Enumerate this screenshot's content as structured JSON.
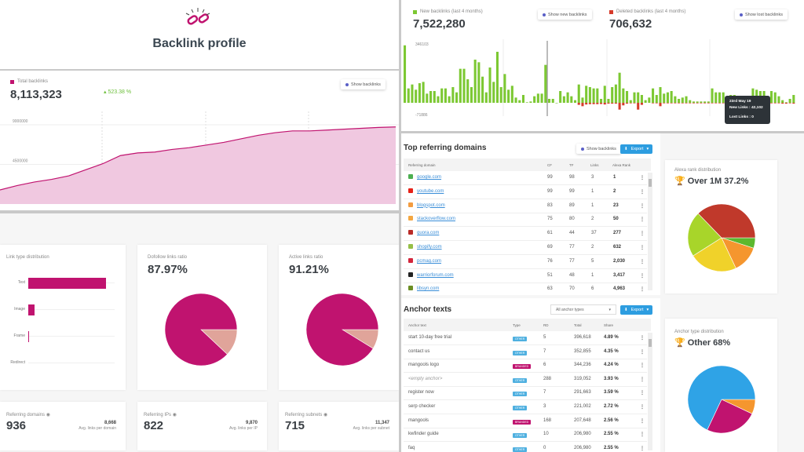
{
  "header": {
    "title": "Backlink profile",
    "icon": "broken-link-icon"
  },
  "total": {
    "label": "Total backlinks",
    "value": "8,113,323",
    "change": "523.38 %",
    "button": "Show backlinks",
    "chart_data": {
      "type": "area",
      "yticks": [
        "9000000",
        "4500000"
      ],
      "ylim": [
        0,
        9800000
      ],
      "values": [
        1600000,
        2100000,
        2500000,
        2800000,
        3200000,
        3900000,
        4600000,
        5500000,
        5800000,
        5900000,
        6200000,
        6400000,
        6700000,
        7000000,
        7400000,
        7800000,
        8100000,
        8300000,
        8300000,
        8400000,
        8500000,
        8600000,
        8700000,
        8750000
      ],
      "color": "#c0136f",
      "fill": "#f0c8e0"
    }
  },
  "newlinks": {
    "label": "New backlinks (last 4 months)",
    "value": "7,522,280",
    "button": "Show new backlinks"
  },
  "deleted": {
    "label": "Deleted backlinks (last 4 months)",
    "value": "706,632",
    "button": "Show lost backlinks"
  },
  "bars": {
    "chart_data": {
      "type": "bar",
      "yticks": [
        "346103",
        "-71886"
      ],
      "ylim": [
        -71886,
        346103
      ],
      "colors": {
        "new": "#7cc832",
        "deleted": "#d63a2a"
      },
      "new": [
        338000,
        84600,
        107700,
        76900,
        115400,
        123000,
        53800,
        69200,
        69200,
        38500,
        84600,
        84600,
        38500,
        92300,
        61500,
        200000,
        200000,
        138400,
        92300,
        253800,
        238400,
        153800,
        61500,
        207600,
        123000,
        300000,
        92300,
        169200,
        76900,
        100000,
        30800,
        15400,
        46100,
        3100,
        7700,
        38500,
        53800,
        53800,
        223000,
        23100,
        23100,
        0,
        69200,
        38500,
        61500,
        38500,
        15400,
        107700,
        30800,
        100000,
        92300,
        84600,
        84600,
        23100,
        100000,
        23100,
        92300,
        107700,
        176900,
        84600,
        69200,
        15400,
        61500,
        61500,
        46100,
        15400,
        30800,
        84600,
        46100,
        92300,
        53800,
        61500,
        69200,
        38500,
        23100,
        30800,
        38500,
        15400,
        7700,
        7700,
        7700,
        7700,
        7700,
        84600,
        61500,
        61500,
        61500,
        15400,
        46100,
        46100,
        7700,
        7700,
        30800,
        7700,
        84600,
        76900,
        69200,
        69200,
        23100,
        69200,
        61500,
        38500,
        15400,
        3100,
        23100,
        46100
      ],
      "deleted": [
        0,
        0,
        0,
        0,
        0,
        0,
        0,
        0,
        0,
        0,
        0,
        0,
        0,
        0,
        0,
        0,
        0,
        0,
        0,
        0,
        0,
        0,
        0,
        0,
        0,
        0,
        0,
        0,
        0,
        0,
        0,
        0,
        0,
        0,
        0,
        0,
        0,
        0,
        0,
        0,
        0,
        0,
        0,
        0,
        0,
        0,
        0,
        -12000,
        -20000,
        -10000,
        -8000,
        -8000,
        -8000,
        -7000,
        -10000,
        -5000,
        -5000,
        -5000,
        -40000,
        -15000,
        -5000,
        -3000,
        -3000,
        -40000,
        -12000,
        0,
        0,
        -3000,
        -3000,
        -20000,
        -3000,
        -3000,
        -3000,
        -3000,
        -3000,
        -3000,
        -3000,
        -3000,
        -3000,
        -3000,
        -3000,
        -3000,
        -3000,
        -3000,
        -3000,
        -3000,
        -3000,
        -3000,
        -3000,
        -40000,
        -30000,
        -25000,
        -15000,
        -5000,
        -5000,
        -3000,
        0,
        0,
        -5000,
        -3000,
        -3000,
        -3000,
        -5000,
        -5000,
        -3000,
        -5000
      ]
    },
    "tooltip": {
      "date": "23rd May 19",
      "new": "New Links : 42,102",
      "lost": "Lost Links : 0"
    }
  },
  "linktype": {
    "title": "Link type distribution",
    "chart_data": {
      "type": "bar",
      "categories": [
        "Text",
        "Image",
        "Frame",
        "Redirect"
      ],
      "values": [
        100,
        8,
        1.5,
        0
      ],
      "color": "#c0136f"
    }
  },
  "dofollow": {
    "title": "Dofollow links ratio",
    "value": "87.97%",
    "chart_data": {
      "type": "pie",
      "values": [
        12.03,
        87.97
      ],
      "colors": [
        "#e0a49a",
        "#c0136f"
      ]
    }
  },
  "active": {
    "title": "Active links ratio",
    "value": "91.21%",
    "chart_data": {
      "type": "pie",
      "values": [
        8.79,
        91.21
      ],
      "colors": [
        "#e0a49a",
        "#c0136f"
      ]
    }
  },
  "stats": [
    {
      "label": "Referring domains",
      "value": "936",
      "sub": "8,668",
      "sublabel": "Avg. links per domain"
    },
    {
      "label": "Referring IPs",
      "value": "822",
      "sub": "9,870",
      "sublabel": "Avg. links per IP"
    },
    {
      "label": "Referring subnets",
      "value": "715",
      "sub": "11,347",
      "sublabel": "Avg. links per subnet"
    }
  ],
  "domains": {
    "title": "Top referring domains",
    "button": "Show backlinks",
    "export": "Export",
    "columns": [
      "Referring domain",
      "CF",
      "TF",
      "Links",
      "Alexa Rank"
    ],
    "rows": [
      [
        "google.com",
        "99",
        "98",
        "3",
        "1",
        "#4caf50"
      ],
      [
        "youtube.com",
        "99",
        "99",
        "1",
        "2",
        "#e62117"
      ],
      [
        "blogspot.com",
        "83",
        "89",
        "1",
        "23",
        "#f39c40"
      ],
      [
        "stackoverflow.com",
        "75",
        "80",
        "2",
        "50",
        "#f4a742"
      ],
      [
        "quora.com",
        "61",
        "44",
        "37",
        "277",
        "#b92b27"
      ],
      [
        "shopify.com",
        "69",
        "77",
        "2",
        "632",
        "#95bf47"
      ],
      [
        "pcmag.com",
        "76",
        "77",
        "5",
        "2,030",
        "#d3253b"
      ],
      [
        "warriorforum.com",
        "51",
        "48",
        "1",
        "3,417",
        "#222222"
      ],
      [
        "libsyn.com",
        "63",
        "70",
        "6",
        "4,963",
        "#6b8e23"
      ]
    ]
  },
  "alexa": {
    "title": "Alexa rank distribution",
    "headline": "Over 1M 37.2%",
    "chart_data": {
      "type": "pie",
      "values": [
        5,
        13,
        23,
        21.8,
        37.2
      ],
      "colors": [
        "#5cb82e",
        "#f5962e",
        "#f0d22a",
        "#a8d52a",
        "#c0392b"
      ]
    }
  },
  "anchors": {
    "title": "Anchor texts",
    "select": "All anchor types",
    "export": "Export",
    "columns": [
      "Anchor text",
      "Type",
      "RD",
      "Total",
      "Share"
    ],
    "rows": [
      [
        "start 10-day free trial",
        "OTHER",
        "5",
        "396,618",
        "4.89 %"
      ],
      [
        "contact us",
        "OTHER",
        "7",
        "352,855",
        "4.35 %"
      ],
      [
        "mangools logo",
        "BRANDED",
        "6",
        "344,236",
        "4.24 %"
      ],
      [
        "<empty anchor>",
        "OTHER",
        "288",
        "319,052",
        "3.93 %"
      ],
      [
        "register now",
        "OTHER",
        "7",
        "291,663",
        "3.59 %"
      ],
      [
        "serp checker",
        "OTHER",
        "3",
        "221,002",
        "2.72 %"
      ],
      [
        "mangools",
        "BRANDED",
        "168",
        "207,648",
        "2.56 %"
      ],
      [
        "kwfinder guide",
        "OTHER",
        "10",
        "206,980",
        "2.55 %"
      ],
      [
        "faq",
        "OTHER",
        "0",
        "206,980",
        "2.55 %"
      ]
    ],
    "badge_colors": {
      "OTHER": "#4fb0e0",
      "BRANDED": "#c0136f"
    }
  },
  "anchortype": {
    "title": "Anchor type distribution",
    "headline": "Other 68%",
    "chart_data": {
      "type": "pie",
      "values": [
        7,
        25,
        68
      ],
      "colors": [
        "#f5962e",
        "#c0136f",
        "#2fa3e6"
      ]
    }
  }
}
